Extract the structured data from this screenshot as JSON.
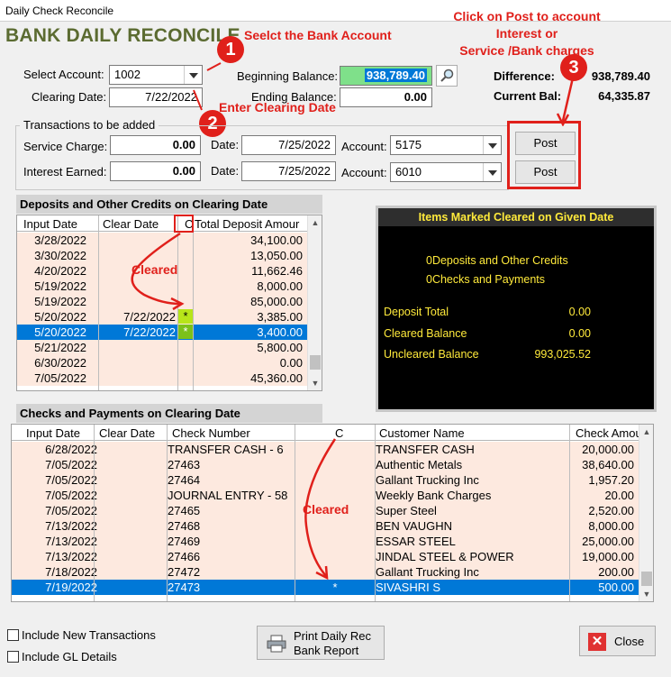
{
  "window": {
    "title": "Daily Check Reconcile"
  },
  "app_title": "BANK DAILY RECONCILE",
  "annotations": {
    "select_bank": "Seelct the Bank Account",
    "enter_date": "Enter Clearing Date",
    "post_line1": "Click on Post to account",
    "post_line2": "Interest or",
    "post_line3": "Service /Bank charges",
    "cleared1": "Cleared",
    "cleared2": "Cleared",
    "badge1": "1",
    "badge2": "2",
    "badge3": "3"
  },
  "form": {
    "select_account_label": "Select Account:",
    "select_account_value": "1002",
    "clearing_date_label": "Clearing Date:",
    "clearing_date_value": "7/22/2022",
    "beginning_balance_label": "Beginning Balance:",
    "beginning_balance_value": "938,789.40",
    "ending_balance_label": "Ending Balance:",
    "ending_balance_value": "0.00",
    "difference_label": "Difference:",
    "difference_value": "938,789.40",
    "current_bal_label": "Current Bal:",
    "current_bal_value": "64,335.87"
  },
  "transactions": {
    "group_title": "Transactions to be added",
    "service_charge_label": "Service Charge:",
    "service_charge_value": "0.00",
    "service_date_label": "Date:",
    "service_date_value": "7/25/2022",
    "service_account_label": "Account:",
    "service_account_value": "5175",
    "post_label_1": "Post",
    "interest_label": "Interest Earned:",
    "interest_value": "0.00",
    "interest_date_label": "Date:",
    "interest_date_value": "7/25/2022",
    "interest_account_label": "Account:",
    "interest_account_value": "6010",
    "post_label_2": "Post"
  },
  "deposits": {
    "title": "Deposits and Other Credits on Clearing Date",
    "headers": [
      "Input Date",
      "Clear Date",
      "C",
      "Total Deposit Amour"
    ],
    "rows": [
      [
        "3/28/2022",
        "",
        "",
        "34,100.00"
      ],
      [
        "3/30/2022",
        "",
        "",
        "13,050.00"
      ],
      [
        "4/20/2022",
        "",
        "",
        "11,662.46"
      ],
      [
        "5/19/2022",
        "",
        "",
        "8,000.00"
      ],
      [
        "5/19/2022",
        "",
        "",
        "85,000.00"
      ],
      [
        "5/20/2022",
        "7/22/2022",
        "*",
        "3,385.00"
      ],
      [
        "5/20/2022",
        "7/22/2022",
        "*",
        "3,400.00"
      ],
      [
        "5/21/2022",
        "",
        "",
        "5,800.00"
      ],
      [
        "6/30/2022",
        "",
        "",
        "0.00"
      ],
      [
        "7/05/2022",
        "",
        "",
        "45,360.00"
      ]
    ],
    "selected_index": 6
  },
  "summary": {
    "title": "Items Marked Cleared on Given Date",
    "deposits_line": "0Deposits and Other Credits",
    "checks_line": "0Checks and Payments",
    "deposit_total_label": "Deposit Total",
    "deposit_total_value": "0.00",
    "cleared_balance_label": "Cleared Balance",
    "cleared_balance_value": "0.00",
    "uncleared_balance_label": "Uncleared Balance",
    "uncleared_balance_value": "993,025.52"
  },
  "checks": {
    "title": "Checks and Payments on Clearing Date",
    "headers": [
      "Input Date",
      "Clear Date",
      "Check Number",
      "C",
      "Customer Name",
      "Check Amou"
    ],
    "rows": [
      [
        "6/28/2022",
        "",
        "TRANSFER CASH - 6",
        "",
        "TRANSFER CASH",
        "20,000.00"
      ],
      [
        "7/05/2022",
        "",
        "27463",
        "",
        "Authentic Metals",
        "38,640.00"
      ],
      [
        "7/05/2022",
        "",
        "27464",
        "",
        "Gallant Trucking Inc",
        "1,957.20"
      ],
      [
        "7/05/2022",
        "",
        "JOURNAL ENTRY - 58",
        "",
        "Weekly Bank Charges",
        "20.00"
      ],
      [
        "7/05/2022",
        "",
        "27465",
        "",
        "Super Steel",
        "2,520.00"
      ],
      [
        "7/13/2022",
        "",
        "27468",
        "",
        "BEN VAUGHN",
        "8,000.00"
      ],
      [
        "7/13/2022",
        "",
        "27469",
        "",
        "ESSAR STEEL",
        "25,000.00"
      ],
      [
        "7/13/2022",
        "",
        "27466",
        "",
        "JINDAL STEEL & POWER",
        "19,000.00"
      ],
      [
        "7/18/2022",
        "",
        "27472",
        "",
        "Gallant Trucking Inc",
        "200.00"
      ],
      [
        "7/19/2022",
        "",
        "27473",
        "*",
        "SIVASHRI S",
        "500.00"
      ]
    ],
    "selected_index": 9
  },
  "footer": {
    "include_new_label": "Include New Transactions",
    "include_gl_label": "Include GL Details",
    "print_line1": "Print Daily Rec",
    "print_line2": "Bank Report",
    "close_label": "Close"
  },
  "colors": {
    "accent_red": "#e0201b",
    "title_green": "#5b6b31",
    "selection": "#0078d7",
    "row_bg": "#fde9df",
    "summary_text": "#ffea3b"
  }
}
